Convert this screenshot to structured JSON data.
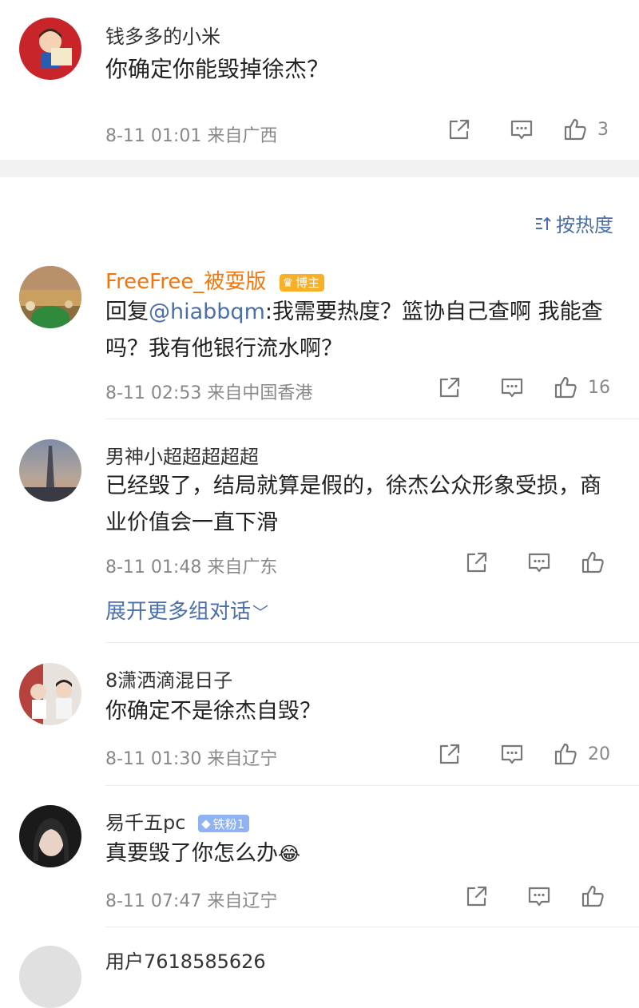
{
  "top_comment": {
    "name": "钱多多的小米",
    "text": "你确定你能毁掉徐杰？",
    "meta": "8-11 01:01 来自广西",
    "likes": "3"
  },
  "sort": {
    "label": "按热度"
  },
  "comments": [
    {
      "name": "FreeFree_被耍版",
      "badge": "博主",
      "reply_prefix": "回复",
      "mention": "@hiabbqm",
      "text": ":我需要热度？篮协自己查啊 我能查吗？我有他银行流水啊？",
      "meta": "8-11 02:53 来自中国香港",
      "likes": "16"
    },
    {
      "name": "男神小超超超超超",
      "text": "已经毁了，结局就算是假的，徐杰公众形象受损，商业价值会一直下滑",
      "meta": "8-11 01:48 来自广东",
      "likes": "",
      "expand": "展开更多组对话"
    },
    {
      "name": "8潇洒滴混日子",
      "text": "你确定不是徐杰自毁？",
      "meta": "8-11 01:30 来自辽宁",
      "likes": "20"
    },
    {
      "name": "易千五pc",
      "badge": "铁粉1",
      "text": "真要毁了你怎么办",
      "emoji": "😂",
      "meta": "8-11 07:47 来自辽宁",
      "likes": ""
    },
    {
      "name": "用户7618585626"
    }
  ]
}
